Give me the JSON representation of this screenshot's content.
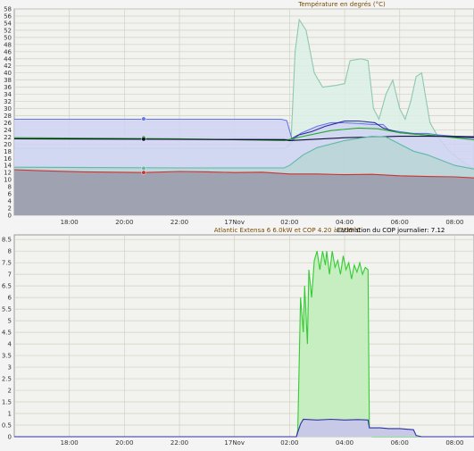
{
  "chart_data": [
    {
      "type": "area",
      "title": "Température en degrés (°C)",
      "ylim": [
        0,
        58
      ],
      "yticks": [
        0,
        2,
        4,
        6,
        8,
        10,
        12,
        14,
        16,
        18,
        20,
        22,
        24,
        26,
        28,
        30,
        32,
        34,
        36,
        38,
        40,
        42,
        44,
        46,
        48,
        50,
        52,
        54,
        56,
        58
      ],
      "xticks": [
        "18:00",
        "20:00",
        "22:00",
        "17Nov",
        "02:00",
        "04:00",
        "06:00",
        "08:00"
      ],
      "xtick_hours": [
        18,
        20,
        22,
        24,
        26,
        28,
        30,
        32
      ],
      "xlim_hours": [
        16.0,
        32.7
      ],
      "grid": true,
      "series": [
        {
          "color": "#8fc8b0",
          "fill": "#dcefe6",
          "fill_opacity": 0.9,
          "points": [
            [
              16.0,
              18.8
            ],
            [
              22.0,
              18.8
            ],
            [
              25.8,
              18.8
            ],
            [
              26.05,
              20
            ],
            [
              26.2,
              46
            ],
            [
              26.35,
              55
            ],
            [
              26.6,
              52
            ],
            [
              26.9,
              40
            ],
            [
              27.2,
              36
            ],
            [
              27.7,
              36.5
            ],
            [
              28.0,
              37
            ],
            [
              28.2,
              43.5
            ],
            [
              28.6,
              44
            ],
            [
              28.85,
              43.5
            ],
            [
              29.05,
              30
            ],
            [
              29.25,
              27
            ],
            [
              29.5,
              34
            ],
            [
              29.75,
              38
            ],
            [
              30.0,
              30
            ],
            [
              30.2,
              27
            ],
            [
              30.4,
              32
            ],
            [
              30.6,
              39
            ],
            [
              30.8,
              40
            ],
            [
              30.95,
              33
            ],
            [
              31.1,
              26
            ],
            [
              31.4,
              22
            ],
            [
              31.8,
              18
            ],
            [
              32.2,
              15.5
            ],
            [
              32.7,
              13
            ]
          ]
        },
        {
          "color": "#6677ee",
          "fill": "#d0d4f2",
          "fill_opacity": 0.85,
          "points": [
            [
              16.0,
              27
            ],
            [
              25.7,
              27
            ],
            [
              25.9,
              26.6
            ],
            [
              26.1,
              21
            ],
            [
              26.4,
              23
            ],
            [
              26.7,
              24
            ],
            [
              27.0,
              25
            ],
            [
              27.5,
              26
            ],
            [
              28.0,
              26
            ],
            [
              28.5,
              25.8
            ],
            [
              29.0,
              25.5
            ],
            [
              29.4,
              25.5
            ],
            [
              29.6,
              24
            ],
            [
              30.0,
              23.5
            ],
            [
              30.5,
              23
            ],
            [
              31.0,
              23
            ],
            [
              31.4,
              22.6
            ],
            [
              32.0,
              22.2
            ],
            [
              32.7,
              22
            ]
          ],
          "markers": [
            [
              20.7,
              27.1
            ]
          ]
        },
        {
          "color": "#2a2a99",
          "fill": "none",
          "points": [
            [
              16.0,
              21.5
            ],
            [
              25.8,
              21.3
            ],
            [
              26.0,
              21.2
            ],
            [
              26.3,
              22.5
            ],
            [
              26.8,
              23.5
            ],
            [
              27.3,
              25
            ],
            [
              28.0,
              26.5
            ],
            [
              28.5,
              26.5
            ],
            [
              29.1,
              26
            ],
            [
              29.4,
              24.5
            ],
            [
              30.0,
              23.2
            ],
            [
              30.6,
              22.8
            ],
            [
              31.2,
              22.4
            ],
            [
              32.0,
              22
            ],
            [
              32.7,
              21.8
            ]
          ]
        },
        {
          "color": "#22aa22",
          "fill": "none",
          "points": [
            [
              16.0,
              21.8
            ],
            [
              22.0,
              21.5
            ],
            [
              25.8,
              21
            ],
            [
              26.5,
              22.2
            ],
            [
              27.5,
              23.8
            ],
            [
              28.5,
              24.5
            ],
            [
              29.2,
              24.3
            ],
            [
              30.0,
              23.2
            ],
            [
              30.5,
              22.8
            ],
            [
              31.0,
              22.6
            ],
            [
              31.5,
              22.2
            ],
            [
              32.7,
              21.2
            ]
          ],
          "markers": [
            [
              20.7,
              21.8
            ]
          ]
        },
        {
          "color": "#111133",
          "fill": "none",
          "points": [
            [
              16.0,
              21.5
            ],
            [
              20.7,
              21.4
            ],
            [
              25.8,
              21.2
            ],
            [
              26.0,
              21.0
            ],
            [
              27.0,
              21.4
            ],
            [
              28.0,
              21.8
            ],
            [
              29.0,
              22.0
            ],
            [
              30.0,
              22.2
            ],
            [
              31.0,
              22.2
            ],
            [
              32.7,
              22.1
            ]
          ],
          "markers": [
            [
              20.7,
              21.4
            ]
          ]
        },
        {
          "color": "#60b8a8",
          "fill": "#b4d6d0",
          "fill_opacity": 0.75,
          "points": [
            [
              16.0,
              13.5
            ],
            [
              22.0,
              13.3
            ],
            [
              25.8,
              13.3
            ],
            [
              26.0,
              14
            ],
            [
              26.5,
              17
            ],
            [
              27.0,
              19
            ],
            [
              28.0,
              21
            ],
            [
              29.0,
              22.2
            ],
            [
              29.5,
              22
            ],
            [
              30.0,
              20
            ],
            [
              30.5,
              18
            ],
            [
              31.0,
              17
            ],
            [
              31.5,
              15.5
            ],
            [
              32.0,
              14
            ],
            [
              32.7,
              13
            ]
          ],
          "markers": [
            [
              20.7,
              13.2
            ]
          ]
        },
        {
          "color": "#cc3333",
          "fill": "#9fa2b0",
          "fill_opacity": 1,
          "points": [
            [
              16.0,
              12.8
            ],
            [
              17.0,
              12.5
            ],
            [
              18.5,
              12.2
            ],
            [
              20.7,
              12.0
            ],
            [
              22.0,
              12.3
            ],
            [
              23.0,
              12.2
            ],
            [
              24.0,
              12.0
            ],
            [
              25.0,
              12.1
            ],
            [
              26.0,
              11.6
            ],
            [
              27.0,
              11.6
            ],
            [
              28.0,
              11.4
            ],
            [
              29.0,
              11.5
            ],
            [
              30.0,
              11.1
            ],
            [
              31.0,
              10.9
            ],
            [
              32.0,
              10.8
            ],
            [
              32.7,
              10.5
            ]
          ],
          "markers": [
            [
              20.7,
              12.0
            ]
          ]
        }
      ]
    },
    {
      "type": "area",
      "title": "Atlantic Extensa 6 6.0kW et COP 4.20 à 7/35°C",
      "annotation": "Estimation du COP journalier: 7.12",
      "ylim": [
        0,
        8.7
      ],
      "yticks": [
        0,
        0.5,
        1,
        1.5,
        2,
        2.5,
        3,
        3.5,
        4,
        4.5,
        5,
        5.5,
        6,
        6.5,
        7,
        7.5,
        8,
        8.5
      ],
      "xticks": [
        "18:00",
        "20:00",
        "22:00",
        "17Nov",
        "02:00",
        "04:00",
        "06:00",
        "08:00"
      ],
      "xtick_hours": [
        18,
        20,
        22,
        24,
        26,
        28,
        30,
        32
      ],
      "xlim_hours": [
        16.0,
        32.7
      ],
      "grid": true,
      "series": [
        {
          "color": "#33cc33",
          "fill": "#c6eec0",
          "fill_opacity": 1,
          "points": [
            [
              16.0,
              0
            ],
            [
              26.25,
              0
            ],
            [
              26.3,
              0.3
            ],
            [
              26.4,
              6.0
            ],
            [
              26.5,
              4.5
            ],
            [
              26.55,
              6.5
            ],
            [
              26.65,
              4.0
            ],
            [
              26.7,
              7.2
            ],
            [
              26.8,
              6.0
            ],
            [
              26.9,
              7.6
            ],
            [
              27.0,
              8.0
            ],
            [
              27.1,
              7.2
            ],
            [
              27.2,
              8.0
            ],
            [
              27.3,
              7.4
            ],
            [
              27.35,
              8.0
            ],
            [
              27.45,
              7.0
            ],
            [
              27.55,
              8.0
            ],
            [
              27.65,
              7.3
            ],
            [
              27.75,
              7.6
            ],
            [
              27.85,
              7.0
            ],
            [
              27.95,
              7.8
            ],
            [
              28.05,
              7.2
            ],
            [
              28.15,
              7.5
            ],
            [
              28.25,
              6.8
            ],
            [
              28.35,
              7.4
            ],
            [
              28.45,
              7.1
            ],
            [
              28.55,
              7.5
            ],
            [
              28.65,
              7.0
            ],
            [
              28.75,
              7.3
            ],
            [
              28.85,
              7.2
            ],
            [
              28.9,
              0.3
            ],
            [
              29.0,
              0
            ],
            [
              32.7,
              0
            ]
          ]
        },
        {
          "color": "#3030aa",
          "fill": "#c7c9e6",
          "fill_opacity": 1,
          "points": [
            [
              16.0,
              0
            ],
            [
              26.25,
              0
            ],
            [
              26.3,
              0.2
            ],
            [
              26.4,
              0.55
            ],
            [
              26.5,
              0.75
            ],
            [
              27.0,
              0.72
            ],
            [
              27.5,
              0.75
            ],
            [
              28.0,
              0.72
            ],
            [
              28.5,
              0.74
            ],
            [
              28.85,
              0.72
            ],
            [
              28.9,
              0.38
            ],
            [
              29.3,
              0.38
            ],
            [
              29.6,
              0.35
            ],
            [
              30.0,
              0.35
            ],
            [
              30.5,
              0.3
            ],
            [
              30.6,
              0.05
            ],
            [
              30.8,
              0
            ],
            [
              32.7,
              0
            ]
          ]
        }
      ]
    }
  ]
}
